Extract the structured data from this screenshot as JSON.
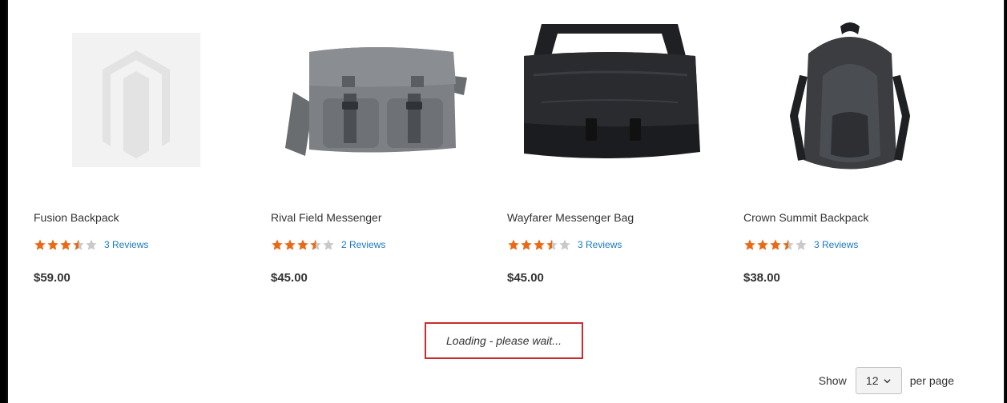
{
  "products": [
    {
      "name": "Fusion Backpack",
      "reviews_label": "3 Reviews",
      "price": "$59.00",
      "rating": 3.5,
      "image_icon": "magento-logo-placeholder-icon"
    },
    {
      "name": "Rival Field Messenger",
      "reviews_label": "2 Reviews",
      "price": "$45.00",
      "rating": 3.5,
      "image_icon": "messenger-bag-image"
    },
    {
      "name": "Wayfarer Messenger Bag",
      "reviews_label": "3 Reviews",
      "price": "$45.00",
      "rating": 3.5,
      "image_icon": "messenger-bag-image"
    },
    {
      "name": "Crown Summit Backpack",
      "reviews_label": "3 Reviews",
      "price": "$38.00",
      "rating": 3.5,
      "image_icon": "backpack-image"
    }
  ],
  "loading": {
    "text": "Loading - please wait..."
  },
  "toolbar": {
    "show_label": "Show",
    "per_page_value": "12",
    "per_page_suffix": "per page"
  },
  "colors": {
    "star_filled": "#e86a16",
    "star_empty": "#c9c9c9",
    "link": "#1979c3",
    "highlight_box": "#cc2b2b"
  }
}
